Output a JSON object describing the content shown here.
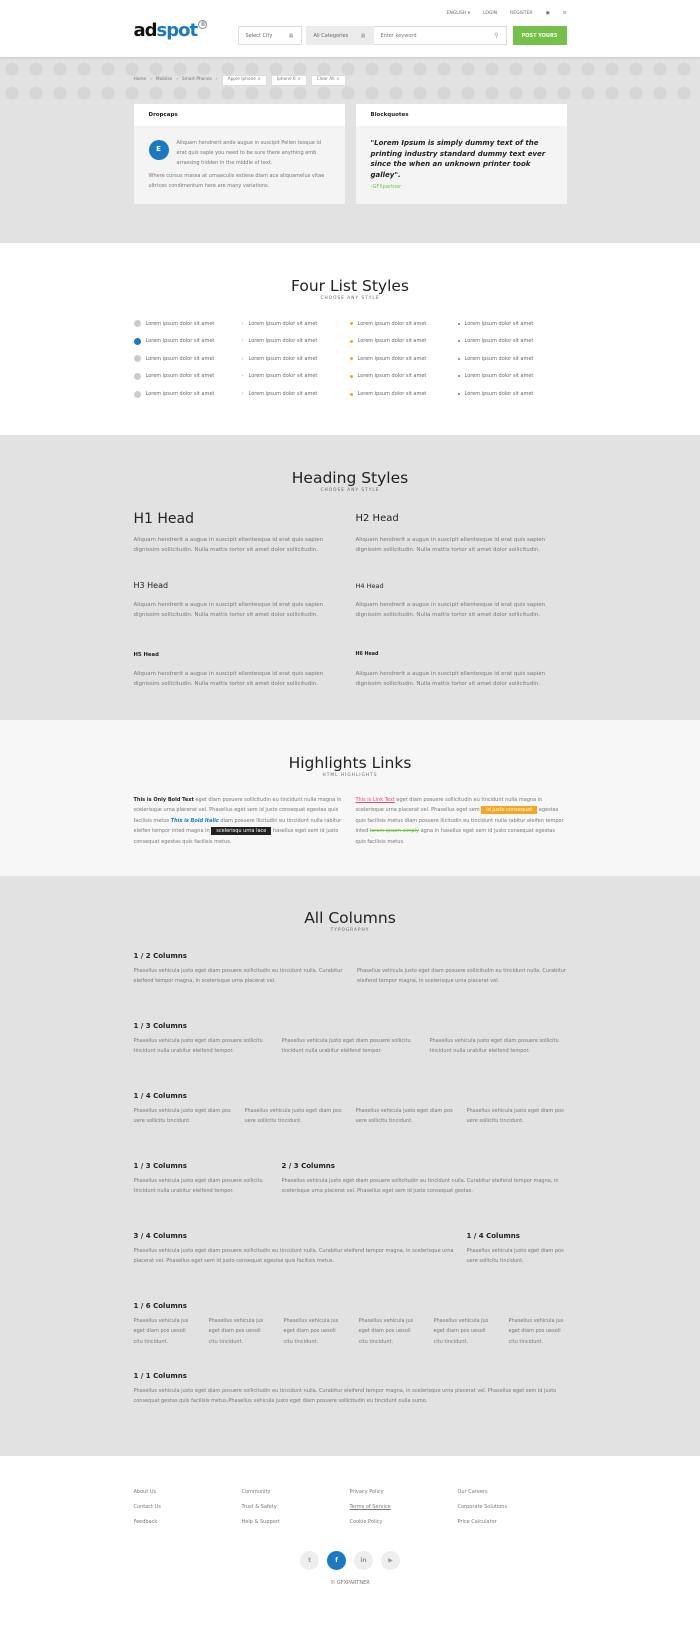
{
  "header": {
    "logo_main": "ad",
    "logo_accent": "spot",
    "logo_mark": "®",
    "nav": [
      "ENGLISH ▾",
      "LOGIN",
      "REGISTER"
    ],
    "nav_icons": [
      "cart-icon",
      "menu-icon"
    ],
    "city_select": "Select City",
    "category_select": "All Categories",
    "keyword_placeholder": "Enter keyword",
    "post_button": "POST YOURS"
  },
  "breadcrumb": {
    "links": [
      "Home",
      "Mobiles",
      "Smart Phones"
    ],
    "filters": [
      "Apple Iphone ×",
      "Iphone 6 ×",
      "Clear All ×"
    ]
  },
  "cards": {
    "dropcaps": {
      "title": "Dropcaps",
      "letter": "E",
      "text1": "Aliquam hendrerit ande augue in suscipit Pellen tesque id erat quis sapie you need to be sure there anything emb arrassing hidden in the middle of text.",
      "text2": "Where cursus massa at urnaaculis estiese diam aca aliquamelus vitae ultrices condimentum here are many variations."
    },
    "blockquotes": {
      "title": "Blockquotes",
      "quote": "\"Lorem Ipsum is simply dummy text of the printing industry standard dummy text ever since the when an unknown printer took galley\".",
      "author": "-GFXpartner"
    }
  },
  "lists": {
    "title": "Four List Styles",
    "subtitle": "CHOOSE ANY STYLE",
    "item": "Lorem ipsum dolor sit amet"
  },
  "headings": {
    "title": "Heading Styles",
    "subtitle": "CHOOSE ANY STYLE",
    "h1": "H1 Head",
    "h2": "H2 Head",
    "h3": "H3 Head",
    "h4": "H4 Head",
    "h5": "H5 Head",
    "h6": "H6 Head",
    "para": "Aliquam hendrerit a augue in suscipit ellentesque id erat quis sapien dignissim sollicitudin. Nulla mattis tortor sit amet dolor sollicitudin."
  },
  "highlights": {
    "title": "Highlights Links",
    "subtitle": "HTML HIGHLIGHTS",
    "left": {
      "bold": "This is Only Bold Text",
      "t1": " eget diam posuere sollicitudin eu tincidunt nulla magna in scelerisque urna placerat vel. Phasellus eget sem id justo consequat egestas quis facilisis metus ",
      "bolditalic": "This is Bold Italic",
      "t2": " diam posuere llicitudin eu tincidunt nulla rabitur eleifen tempor inted magna in ",
      "mark": "scelerisqu urna lace",
      "t3": " hasellus eget sem id justo consequat egestas quis facilisis metus."
    },
    "right": {
      "link": "This is Link Text",
      "t1": " eget diam posuere sollicitudin eu tincidunt nulla magna in scelerisque urna placerat vel. Phasellus eget sem ",
      "hl": "id justo consequat",
      "t2": " egestas quis facilisis metus diam posuere llicitudin eu tincidunt nulla rabitur eleifen tempor inted ",
      "strike": "lorem ipsum simply",
      "t3": " agna in hasellus eget sem id justo consequat egestas quis facilisis metus."
    }
  },
  "columns": {
    "title": "All Columns",
    "subtitle": "TYPOGRAPHY",
    "half": "1 / 2 Columns",
    "third": "1 / 3 Columns",
    "quarter": "1 / 4 Columns",
    "twothirds": "2 / 3 Columns",
    "threequarters": "3 / 4 Columns",
    "sixth": "1 / 6 Columns",
    "full": "1 / 1 Columns",
    "p_half": "Phasellus vehicula justo eget diam posuere sollicitudin eu tincidunt nulla. Curabitur eleifend tempor magna, in scelerisque urna placerat vel.",
    "p_third": "Phasellus vehicula justo eget diam posuere sollicitu tincidunt nulla urabitur eleifend tempor.",
    "p_quarter": "Phasellus vehicula justo eget diam pos uere sollicitu tincidunt.",
    "p_twothirds": "Phasellus vehicula justo eget diam posuere sollicitudin eu tincidunt nulla. Curabitur eleifend tempor magna, in scelerisque urna placerat vel. Phasellus eget sem id justo consequat gestas.",
    "p_threequarters": "Phasellus vehicula justo eget diam posuere sollicitudin eu tincidunt nulla. Curabitur eleifend tempor magna, in scelerisque urna placerat vel. Phasellus eget sem id justo consequat egestas quis facilisis metus.",
    "p_quarter2": "Phasellus vehicula justo eget diam pos uere sollicitu tincidunt.",
    "p_sixth": "Phasellus vehicula jus eget diam pos uesoli citu tincidunt.",
    "p_full": "Phasellus vehicula justo eget diam posuere sollicitudin eu tincidunt nulla. Curabitur eleifend tempor magna, in scelerisque urna placerat vel. Phasellus eget sem id justo consequat gestas quis facilisis metus.Phasellus vehicula justo eget diam posuere sollicitudin eu tincidunt nulla sumo."
  },
  "footer": {
    "cols": [
      [
        "About Us",
        "Contact Us",
        "Feedback"
      ],
      [
        "Community",
        "Trust & Safety",
        "Help & Support"
      ],
      [
        "Privacy Policy",
        "Terms of Service",
        "Cookie Policy"
      ],
      [
        "Our Careers",
        "Corporate Solutions",
        "Price Calculator"
      ]
    ],
    "social": [
      "t",
      "f",
      "in",
      "▶"
    ],
    "copyright": "© GFXPARTNER"
  }
}
